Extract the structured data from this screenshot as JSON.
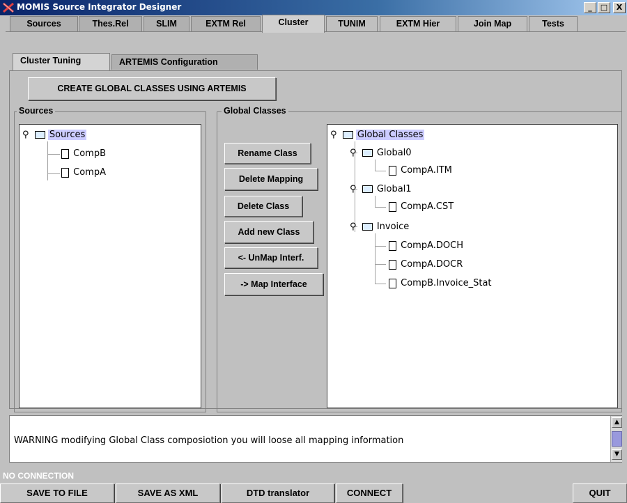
{
  "window": {
    "title": "MOMIS Source Integrator Designer",
    "buttons": [
      "_",
      "□",
      "X"
    ]
  },
  "main_tabs": [
    {
      "label": "Sources"
    },
    {
      "label": "Thes.Rel"
    },
    {
      "label": "SLIM"
    },
    {
      "label": "EXTM Rel"
    },
    {
      "label": "Cluster",
      "active": true
    },
    {
      "label": "TUNIM"
    },
    {
      "label": "EXTM Hier"
    },
    {
      "label": "Join Map"
    },
    {
      "label": "Tests"
    }
  ],
  "sub_tabs": [
    {
      "label": "Cluster Tuning",
      "active": true
    },
    {
      "label": "ARTEMIS Configuration"
    }
  ],
  "create_button": "CREATE GLOBAL CLASSES USING ARTEMIS",
  "sources_panel": {
    "title": "Sources",
    "tree": {
      "root": "Sources",
      "children": [
        "CompB",
        "CompA"
      ]
    }
  },
  "global_panel": {
    "title": "Global Classes",
    "buttons": [
      "Rename Class",
      "Delete Mapping",
      "Delete Class",
      "Add new Class",
      "<- UnMap Interf.",
      "-> Map Interface"
    ],
    "tree": {
      "root": "Global Classes",
      "groups": [
        {
          "name": "Global0",
          "children": [
            "CompA.ITM"
          ]
        },
        {
          "name": "Global1",
          "children": [
            "CompA.CST"
          ]
        },
        {
          "name": "Invoice",
          "children": [
            "CompA.DOCH",
            "CompA.DOCR",
            "CompB.Invoice_Stat"
          ]
        }
      ]
    }
  },
  "warning": "WARNING modifying Global Class composiotion you will loose all mapping information",
  "status": "NO CONNECTION",
  "bottom_buttons": [
    "SAVE TO FILE",
    "SAVE AS XML",
    "DTD translator",
    "CONNECT",
    "QUIT"
  ],
  "colors": {
    "titlebar": "#0a246a",
    "selection": "#ccccff",
    "status_text": "#ffffff"
  }
}
